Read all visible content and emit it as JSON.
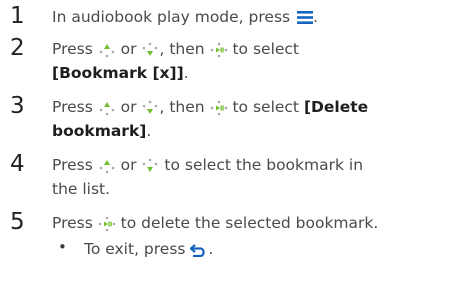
{
  "steps": [
    {
      "num": "1",
      "text_a": "In audiobook play mode, press",
      "text_b": "."
    },
    {
      "num": "2",
      "text_a": "Press",
      "or": "or",
      "text_b": ", then",
      "text_c": "to select",
      "bold": "[Bookmark [x]]",
      "tail": "."
    },
    {
      "num": "3",
      "text_a": "Press",
      "or": "or",
      "text_b": ", then",
      "text_c": "to select",
      "bold_1": "[Delete",
      "bold_2": "bookmark]",
      "tail": "."
    },
    {
      "num": "4",
      "text_a": "Press",
      "or": "or",
      "text_b": "to select the bookmark in",
      "text_c": "the list."
    },
    {
      "num": "5",
      "text_a": "Press",
      "text_b": "to delete the selected bookmark."
    }
  ],
  "sub": {
    "bullet": "•",
    "text_a": "To exit, press",
    "text_b": "."
  },
  "colors": {
    "accent": "#1565c0",
    "dots": "#6fbf2e",
    "text": "#4a4a4a"
  },
  "icons": [
    "menu-icon",
    "up-key-icon",
    "down-key-icon",
    "play-pause-key-icon",
    "back-icon"
  ]
}
